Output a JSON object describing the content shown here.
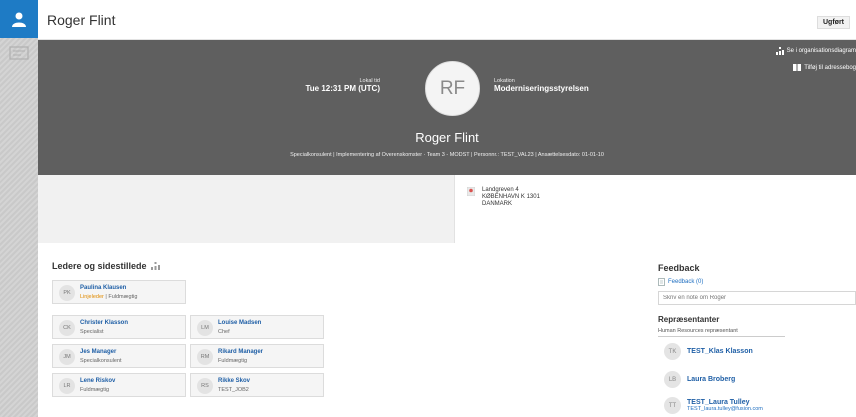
{
  "header": {
    "title": "Roger Flint",
    "done_label": "Ugført"
  },
  "profile": {
    "org_diagram_link": "Se i organisationsdiagram",
    "addressbook_link": "Tilføj til adressebog",
    "initials": "RF",
    "local_time_label": "Lokal tid",
    "local_time": "Tue 12:31 PM (UTC)",
    "location_label": "Lokation",
    "location": "Moderniseringsstyrelsen",
    "name": "Roger Flint",
    "subtitle": "Specialkonsulent  |  Implementering af Overenskomster · Team 3 - MODST  |  Personnr.: TEST_VAL23  |  Ansættelsesdato: 01-01-10"
  },
  "address": {
    "line1": "Landgreven 4",
    "line2": "KØBENHAVN K 1301",
    "line3": "DANMARK"
  },
  "managers": {
    "title": "Ledere og sidestillede",
    "manager": {
      "initials": "PK",
      "name": "Paulina Klausen",
      "role_highlight": "Linjeleder",
      "role_rest": " | Fuldmægtig"
    },
    "peers": [
      {
        "initials": "CK",
        "name": "Christer Klasson",
        "role": "Specialist"
      },
      {
        "initials": "LM",
        "name": "Louise Madsen",
        "role": "Chef"
      },
      {
        "initials": "JM",
        "name": "Jes Manager",
        "role": "Specialkonsulent"
      },
      {
        "initials": "RM",
        "name": "Rikard Manager",
        "role": "Fuldmægtig"
      },
      {
        "initials": "LR",
        "name": "Lene Riskov",
        "role": "Fuldmægtig"
      },
      {
        "initials": "RS",
        "name": "Rikke Skov",
        "role": "TEST_JOB2"
      }
    ]
  },
  "feedback": {
    "title": "Feedback",
    "link": "Feedback (0)",
    "placeholder": "Skriv en note om Roger"
  },
  "reps": {
    "title": "Repræsentanter",
    "subtitle": "Human Resources repræsentant",
    "items": [
      {
        "initials": "TK",
        "name": "TEST_Klas Klasson",
        "email": ""
      },
      {
        "initials": "LB",
        "name": "Laura Broberg",
        "email": ""
      },
      {
        "initials": "TT",
        "name": "TEST_Laura Tulley",
        "email": "TEST_laura.tulley@fusion.com"
      }
    ]
  },
  "colors": {
    "accent": "#1e7bc5",
    "header_bg": "#5f5f5f",
    "link": "#1f5fa6",
    "highlight": "#e08a00"
  }
}
